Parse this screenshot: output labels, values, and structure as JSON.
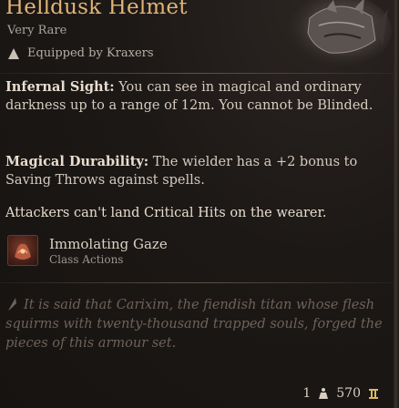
{
  "item": {
    "title": "Helldusk Helmet",
    "rarity": "Very Rare",
    "equipped_text": "Equipped by Kraxers"
  },
  "properties": [
    {
      "name": "Infernal Sight:",
      "text": " You can see in magical and ordinary darkness up to a range of 12m. You cannot be Blinded."
    },
    {
      "name": "Magical Durability:",
      "text": " The wielder has a +2 bonus to Saving Throws against spells."
    },
    {
      "name": "",
      "text": "Attackers can't land Critical Hits on the wearer."
    }
  ],
  "action": {
    "name": "Immolating Gaze",
    "type": "Class Actions"
  },
  "flavor": "It is said that Carixim, the fiendish titan whose flesh squirms with twenty-thousand trapped souls, forged the pieces of this armour set.",
  "footer": {
    "weight": "1",
    "value": "570"
  },
  "colors": {
    "title": "#e0b476",
    "background": "#1b1715"
  },
  "icons": {
    "equipped": "triangle-person-icon",
    "action": "immolating-gaze-icon",
    "flavor": "feather-icon",
    "weight": "weight-icon",
    "gold": "gold-coin-icon"
  }
}
